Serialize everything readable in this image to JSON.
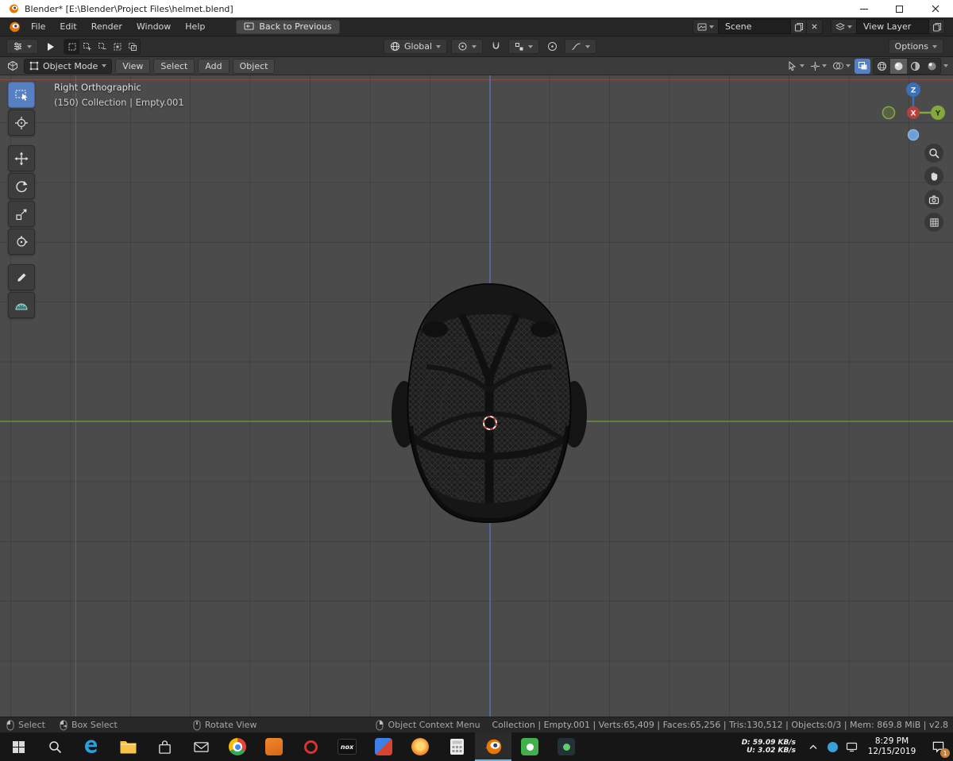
{
  "window": {
    "title": "Blender* [E:\\Blender\\Project Files\\helmet.blend]"
  },
  "topbar": {
    "menus": [
      "File",
      "Edit",
      "Render",
      "Window",
      "Help"
    ],
    "back_button": "Back to Previous",
    "scene_label": "Scene",
    "view_layer_label": "View Layer"
  },
  "tool_settings": {
    "orientation": "Global",
    "options_label": "Options"
  },
  "header": {
    "mode": "Object Mode",
    "menus": [
      "View",
      "Select",
      "Add",
      "Object"
    ]
  },
  "viewport": {
    "view_label": "Right Orthographic",
    "context_label": "(150) Collection | Empty.001",
    "axes": {
      "x": "X",
      "y": "Y",
      "z": "Z"
    }
  },
  "statusbar": {
    "hints": [
      {
        "icon": "mouse-left-icon",
        "label": "Select"
      },
      {
        "icon": "mouse-drag-icon",
        "label": "Box Select"
      },
      {
        "icon": "mouse-middle-icon",
        "label": "Rotate View"
      },
      {
        "icon": "mouse-right-icon",
        "label": "Object Context Menu"
      }
    ],
    "info": "Collection | Empty.001 | Verts:65,409 | Faces:65,256 | Tris:130,512 | Objects:0/3 | Mem: 869.8 MiB | v2.8"
  },
  "taskbar": {
    "icons": [
      "start",
      "search",
      "edge",
      "file-explorer",
      "store",
      "mail",
      "chrome",
      "app-orange",
      "opera",
      "nox",
      "app-blue",
      "app-flame",
      "calculator",
      "blender",
      "app-green",
      "app-dark"
    ],
    "nox_label": "nox",
    "tray": {
      "download_label": "D:",
      "download_value": "59.09 KB/s",
      "upload_label": "U:",
      "upload_value": "3.02 KB/s",
      "time": "8:29 PM",
      "date": "12/15/2019",
      "notification_badge": "1"
    }
  },
  "colors": {
    "accent_blue": "#5680c2",
    "axis_x": "#b4413e",
    "axis_y": "#84a83c",
    "axis_z": "#3b6fb7",
    "blender_orange": "#ea7600",
    "viewport_bg": "#4b4b4b"
  }
}
